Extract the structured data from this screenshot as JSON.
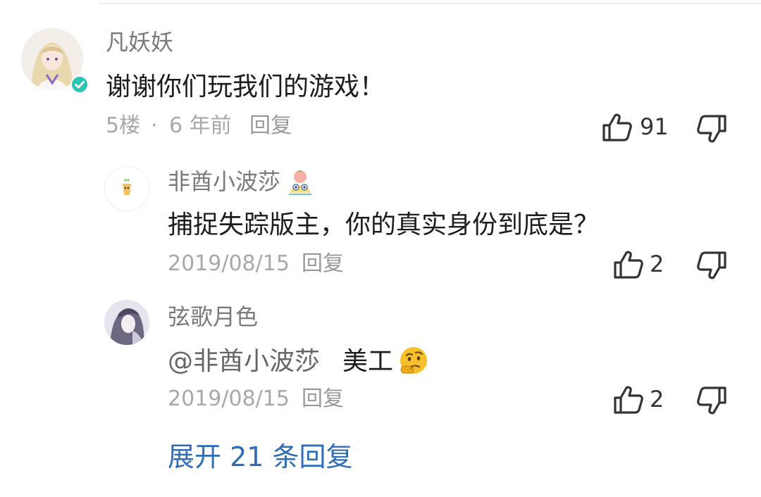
{
  "comment": {
    "username": "凡妖妖",
    "text": "谢谢你们玩我们的游戏！",
    "floor": "5楼",
    "separator": "·",
    "time": "6 年前",
    "reply_label": "回复",
    "likes": "91"
  },
  "replies": [
    {
      "username": "非酋小波莎",
      "text": "捕捉失踪版主，你的真实身份到底是？",
      "date": "2019/08/15",
      "reply_label": "回复",
      "likes": "2"
    },
    {
      "username": "弦歌月色",
      "mention": "@非酋小波莎",
      "text": "美工",
      "date": "2019/08/15",
      "reply_label": "回复",
      "likes": "2"
    }
  ],
  "expand_label": "展开 21 条回复",
  "colors": {
    "verified_badge": "#29c3b4",
    "link": "#2f6db8",
    "emoji_face": "#f5c02c"
  },
  "icons": {
    "like": "thumbs-up-icon",
    "dislike": "thumbs-down-icon",
    "verified": "verified-badge-icon",
    "thinking": "thinking-face-emoji"
  }
}
